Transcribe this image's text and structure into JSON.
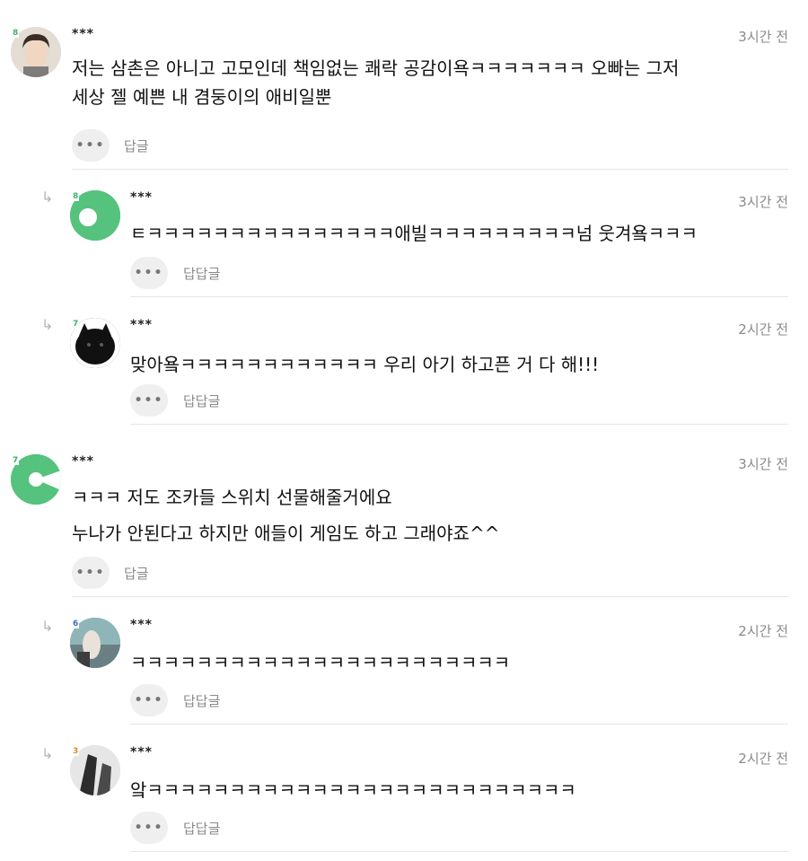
{
  "comments": [
    {
      "username": "***",
      "level": "8",
      "time": "3시간 전",
      "lines": [
        "저는 삼촌은 아니고 고모인데 책임없는 쾌락 공감이욕ㅋㅋㅋㅋㅋㅋㅋ 오빠는 그저",
        "세상 젤 예쁜 내 겸둥이의 애비일뿐"
      ],
      "more_label": "•••",
      "reply_label": "답글"
    },
    {
      "username": "***",
      "level": "8",
      "time": "3시간 전",
      "lines": [
        "ㅌㅋㅋㅋㅋㅋㅋㅋㅋㅋㅋㅋㅋㅋㅋㅋ애빌ㅋㅋㅋㅋㅋㅋㅋㅋㅋ넘 웃겨욬ㅋㅋㅋ"
      ],
      "more_label": "•••",
      "reply_label": "답답글"
    },
    {
      "username": "***",
      "level": "7",
      "time": "2시간 전",
      "lines": [
        "맞아욬ㅋㅋㅋㅋㅋㅋㅋㅋㅋㅋㅋㅋ 우리 아기 하고픈 거 다 해!!!"
      ],
      "more_label": "•••",
      "reply_label": "답답글"
    },
    {
      "username": "***",
      "level": "7",
      "time": "3시간 전",
      "lines": [
        "ㅋㅋㅋ 저도 조카들 스위치 선물해줄거에요",
        "누나가 안된다고 하지만 애들이 게임도 하고 그래야죠^^"
      ],
      "more_label": "•••",
      "reply_label": "답글"
    },
    {
      "username": "***",
      "level": "6",
      "time": "2시간 전",
      "lines": [
        "ㅋㅋㅋㅋㅋㅋㅋㅋㅋㅋㅋㅋㅋㅋㅋㅋㅋㅋㅋㅋㅋㅋㅋ"
      ],
      "more_label": "•••",
      "reply_label": "답답글"
    },
    {
      "username": "***",
      "level": "3",
      "time": "2시간 전",
      "lines": [
        "앜ㅋㅋㅋㅋㅋㅋㅋㅋㅋㅋㅋㅋㅋㅋㅋㅋㅋㅋㅋㅋㅋㅋㅋㅋㅋㅋ"
      ],
      "more_label": "•••",
      "reply_label": "답답글"
    }
  ],
  "reply_arrow_icon": "↳",
  "colors": {
    "level_green": "#3bb36a",
    "level_blue": "#3a6ad4",
    "level_orange": "#e0862a",
    "avatar_green": "#55c27d"
  }
}
